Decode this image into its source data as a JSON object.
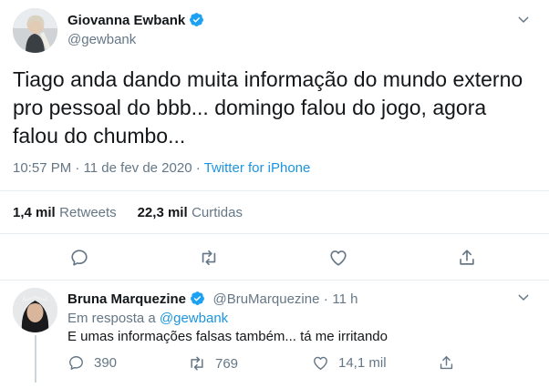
{
  "main_tweet": {
    "author_name": "Giovanna Ewbank",
    "author_handle": "@gewbank",
    "text": "Tiago anda dando muita informação do mundo externo pro pessoal do bbb... domingo falou do jogo, agora falou do chumbo...",
    "time": "10:57 PM",
    "separator": "·",
    "date": "11 de fev de 2020",
    "source": "Twitter for iPhone",
    "retweets_count": "1,4 mil",
    "retweets_label": "Retweets",
    "likes_count": "22,3 mil",
    "likes_label": "Curtidas",
    "actions": [
      "reply-icon",
      "retweet-icon",
      "like-icon",
      "share-icon"
    ]
  },
  "reply": {
    "author_name": "Bruna Marquezine",
    "author_handle": "@BruMarquezine",
    "separator": "·",
    "age": "11 h",
    "reply_to_label": "Em resposta a",
    "reply_to_handle": "@gewbank",
    "text": "E umas informações falsas também... tá me irritando",
    "reply_count": "390",
    "retweet_count": "769",
    "like_count": "14,1 mil"
  },
  "colors": {
    "verified": "#1da1f2",
    "link": "#1b95e0",
    "secondary_text": "#657786",
    "divider": "#e6ecf0"
  }
}
